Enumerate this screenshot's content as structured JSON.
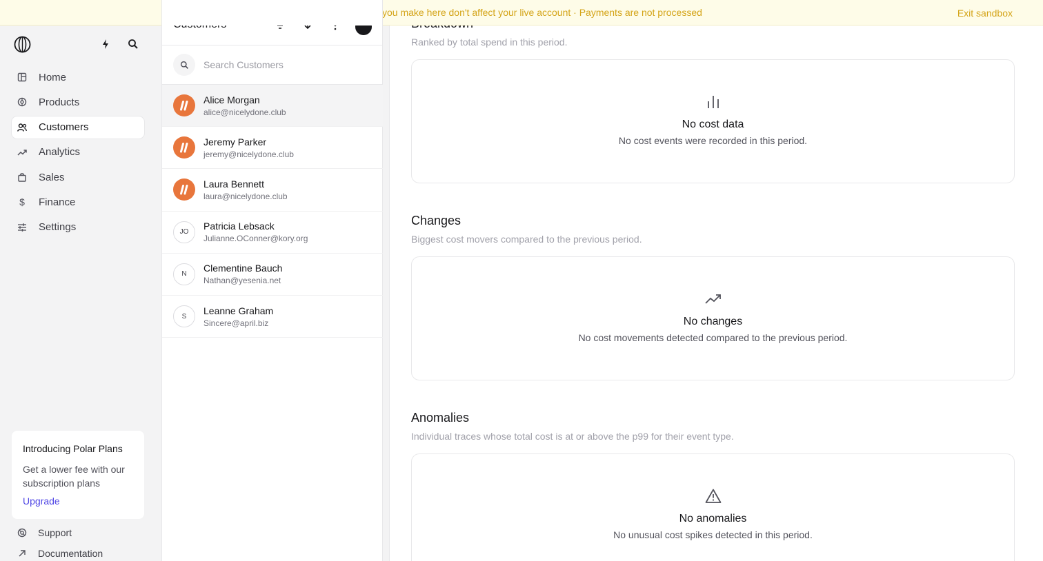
{
  "banner": {
    "message": "Changes you make here don't affect your live account · Payments are not processed",
    "exit_label": "Exit sandbox"
  },
  "sidebar": {
    "items": [
      {
        "label": "Home",
        "icon": "home-icon"
      },
      {
        "label": "Products",
        "icon": "products-icon"
      },
      {
        "label": "Customers",
        "icon": "customers-icon",
        "active": true
      },
      {
        "label": "Analytics",
        "icon": "analytics-icon"
      },
      {
        "label": "Sales",
        "icon": "sales-icon"
      },
      {
        "label": "Finance",
        "icon": "finance-icon"
      },
      {
        "label": "Settings",
        "icon": "settings-icon"
      }
    ],
    "promo": {
      "title": "Introducing Polar Plans",
      "body": "Get a lower fee with our subscription plans",
      "link": "Upgrade"
    },
    "support_label": "Support",
    "docs_label": "Documentation"
  },
  "customers": {
    "title": "Customers",
    "search_placeholder": "Search Customers",
    "rows": [
      {
        "name": "Alice Morgan",
        "email": "alice@nicelydone.club",
        "avatar": "logo"
      },
      {
        "name": "Jeremy Parker",
        "email": "jeremy@nicelydone.club",
        "avatar": "logo"
      },
      {
        "name": "Laura Bennett",
        "email": "laura@nicelydone.club",
        "avatar": "logo"
      },
      {
        "name": "Patricia Lebsack",
        "email": "Julianne.OConner@kory.org",
        "initials": "JO"
      },
      {
        "name": "Clementine Bauch",
        "email": "Nathan@yesenia.net",
        "initials": "N"
      },
      {
        "name": "Leanne Graham",
        "email": "Sincere@april.biz",
        "initials": "S"
      }
    ]
  },
  "main": {
    "breakdown": {
      "title": "Breakdown",
      "subtitle": "Ranked by total spend in this period.",
      "empty_title": "No cost data",
      "empty_text": "No cost events were recorded in this period."
    },
    "changes": {
      "title": "Changes",
      "subtitle": "Biggest cost movers compared to the previous period.",
      "empty_title": "No changes",
      "empty_text": "No cost movements detected compared to the previous period."
    },
    "anomalies": {
      "title": "Anomalies",
      "subtitle": "Individual traces whose total cost is at or above the p99 for their event type.",
      "empty_title": "No anomalies",
      "empty_text": "No unusual cost spikes detected in this period."
    }
  },
  "colors": {
    "banner_text": "#d4a418",
    "banner_bg": "#fefce8",
    "accent": "#4f46e5",
    "avatar_orange": "#e8763c"
  }
}
